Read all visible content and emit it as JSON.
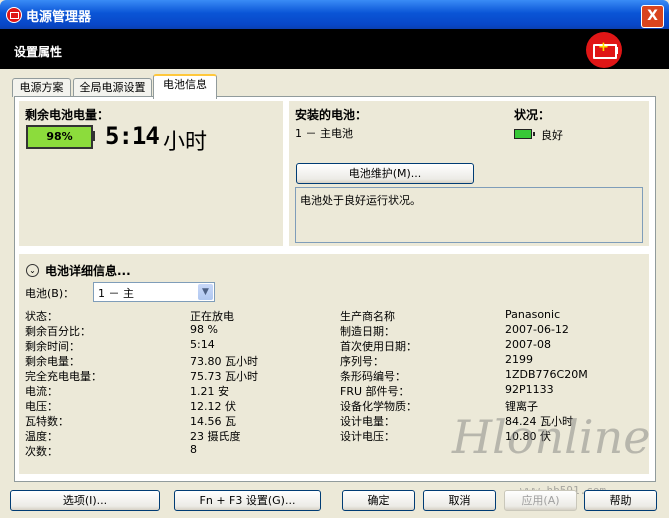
{
  "window": {
    "title": "电源管理器",
    "close_label": "X"
  },
  "header": {
    "title": "设置属性"
  },
  "tabs": [
    {
      "label": "电源方案"
    },
    {
      "label": "全局电源设置"
    },
    {
      "label": "电池信息"
    }
  ],
  "remaining": {
    "label": "剩余电池电量：",
    "percent_label": "98%",
    "percent": 98,
    "time": "5:14",
    "unit": "小时"
  },
  "installed": {
    "label": "安装的电池：",
    "value": "1 － 主电池"
  },
  "status": {
    "label": "状况：",
    "value": "良好"
  },
  "maintenance_button": "电池维护(M)...",
  "message": "电池处于良好运行状况。",
  "details": {
    "title": "电池详细信息...",
    "battery_label": "电池(B)：",
    "battery_selected": "1 － 主",
    "left": [
      {
        "k": "状态：",
        "v": "正在放电"
      },
      {
        "k": "剩余百分比：",
        "v": "98 %"
      },
      {
        "k": "剩余时间：",
        "v": "5:14"
      },
      {
        "k": "剩余电量：",
        "v": "73.80 瓦小时"
      },
      {
        "k": "完全充电电量：",
        "v": "75.73 瓦小时"
      },
      {
        "k": "电流：",
        "v": "1.21 安"
      },
      {
        "k": "电压：",
        "v": "12.12 伏"
      },
      {
        "k": "瓦特数：",
        "v": "14.56 瓦"
      },
      {
        "k": "温度：",
        "v": "23 摄氏度"
      },
      {
        "k": "次数：",
        "v": "8"
      }
    ],
    "right": [
      {
        "k": "生产商名称",
        "v": "Panasonic"
      },
      {
        "k": "制造日期：",
        "v": "2007-06-12"
      },
      {
        "k": "首次使用日期：",
        "v": "2007-08"
      },
      {
        "k": "序列号：",
        "v": "2199"
      },
      {
        "k": "条形码编号：",
        "v": "1ZDB776C20M"
      },
      {
        "k": "FRU 部件号：",
        "v": "92P1133"
      },
      {
        "k": "设备化学物质：",
        "v": "锂离子"
      },
      {
        "k": "设计电量：",
        "v": "84.24 瓦小时"
      },
      {
        "k": "设计电压：",
        "v": "10.80 伏"
      }
    ]
  },
  "footer": {
    "options": "选项(I)...",
    "fn_settings": "Fn + F3 设置(G)...",
    "ok": "确定",
    "cancel": "取消",
    "apply": "应用(A)",
    "help": "帮助"
  },
  "watermark": {
    "text": "Hlonline",
    "url": "www.hb591.com"
  }
}
